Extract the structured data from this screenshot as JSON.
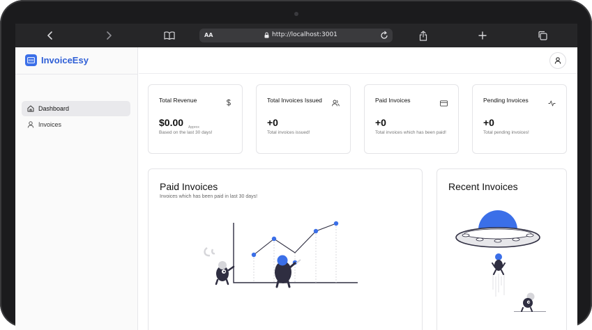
{
  "browser": {
    "text_size_label": "AA",
    "url": "http://localhost:3001"
  },
  "brand": {
    "name": "InvoiceEsy"
  },
  "sidebar": {
    "items": [
      {
        "label": "Dashboard",
        "icon": "home-icon",
        "active": true
      },
      {
        "label": "Invoices",
        "icon": "user-icon",
        "active": false
      }
    ]
  },
  "stats": [
    {
      "title": "Total Revenue",
      "icon": "dollar-icon",
      "value": "$0.00",
      "approx": "Approx",
      "description": "Based on the last 30 days!"
    },
    {
      "title": "Total Invoices Issued",
      "icon": "users-icon",
      "value": "+0",
      "description": "Total invoices issued!"
    },
    {
      "title": "Paid Invoices",
      "icon": "credit-card-icon",
      "value": "+0",
      "description": "Total invoices which has been paid!"
    },
    {
      "title": "Pending Invoices",
      "icon": "activity-icon",
      "value": "+0",
      "description": "Total pending invoices!"
    }
  ],
  "paid_panel": {
    "title": "Paid Invoices",
    "subtitle": "Invoices which has been paid in last 30 days!"
  },
  "recent_panel": {
    "title": "Recent Invoices"
  },
  "colors": {
    "accent": "#3b6fe8",
    "dark": "#2f2e41",
    "toolbar": "#262628"
  }
}
